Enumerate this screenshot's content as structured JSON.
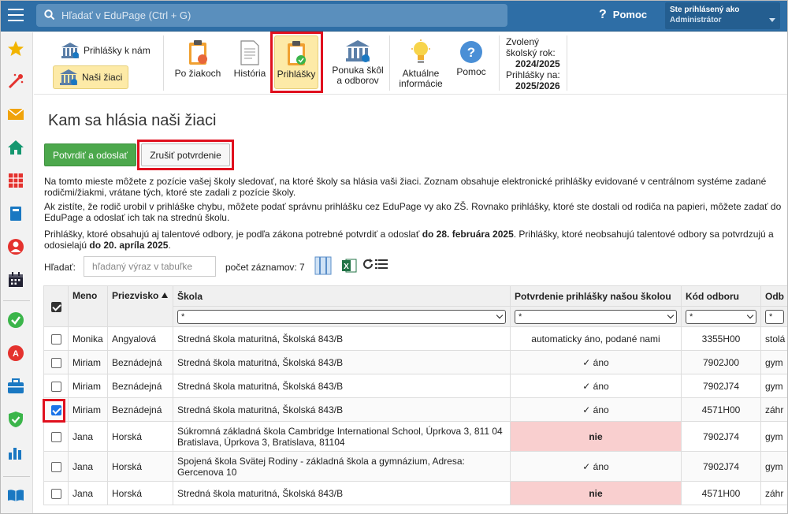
{
  "search": {
    "placeholder": "Hľadať v EduPage (Ctrl + G)"
  },
  "header": {
    "help_label": "Pomoc",
    "user_line1": "Ste prihlásený ako",
    "user_line2": "Administrátor"
  },
  "sidebar": {
    "icons": [
      "star-icon",
      "magic-wand-icon",
      "envelope-icon",
      "home-icon",
      "timetable-grid-icon",
      "book-icon",
      "person-icon",
      "calendar-icon",
      "check-circle-icon",
      "badge-icon",
      "briefcase-icon",
      "shield-check-icon",
      "bar-chart-icon",
      "open-book-icon"
    ]
  },
  "toolbar": {
    "prihlasky_k_nam": "Prihlášky k nám",
    "nasi_ziaci": "Naši žiaci",
    "po_ziakoch": "Po žiakoch",
    "historia": "História",
    "prihlasky": "Prihlášky",
    "ponuka_1": "Ponuka škôl",
    "ponuka_2": "a odborov",
    "aktualne_1": "Aktuálne",
    "aktualne_2": "informácie",
    "pomoc": "Pomoc",
    "year_l1": "Zvolený",
    "year_l2": "školský rok:",
    "year_v1": "2024/2025",
    "year_l3": "Prihlášky na:",
    "year_v2": "2025/2026"
  },
  "page": {
    "title": "Kam sa hlásia naši žiaci",
    "confirm_button": "Potvrdiť a odoslať",
    "cancel_button": "Zrušiť potvrdenie",
    "p1": "Na tomto mieste môžete z pozície vašej školy sledovať, na ktoré školy sa hlásia vaši žiaci. Zoznam obsahuje elektronické prihlášky evidované v centrálnom systéme zadané rodičmi/žiakmi, vrátane tých, ktoré ste zadali z pozície školy.",
    "p2": "Ak zistíte, že rodič urobil v prihláške chybu, môžete podať správnu prihlášku cez EduPage vy ako ZŠ. Rovnako prihlášky, ktoré ste dostali od rodiča na papieri, môžete zadať do EduPage a odoslať ich tak na strednú školu.",
    "p3a": "Prihlášky, ktoré obsahujú aj talentové odbory, je podľa zákona potrebné potvrdiť a odoslať ",
    "p3b": "do 28. februára 2025",
    "p3c": ". Prihlášky, ktoré neobsahujú talentové odbory sa potvrdzujú a odosielajú ",
    "p3d": "do 20. apríla 2025",
    "p3e": ".",
    "search_label": "Hľadať:",
    "search_placeholder": "hľadaný výraz v tabuľke",
    "count_label": "počet záznamov: 7"
  },
  "table": {
    "headers": {
      "meno": "Meno",
      "priezvisko": "Priezvisko",
      "skola": "Škola",
      "potvrdenie": "Potvrdenie prihlášky našou školou",
      "kod": "Kód odboru",
      "odbor": "Odb"
    },
    "filter": "*",
    "rows": [
      {
        "meno": "Monika",
        "priezvisko": "Angyalová",
        "skola": "Stredná škola maturitná, Školská 843/B",
        "potvrdenie": "automaticky áno, podané nami",
        "kod": "3355H00",
        "odbor": "stolá",
        "checked": false,
        "nie": false
      },
      {
        "meno": "Miriam",
        "priezvisko": "Beznádejná",
        "skola": "Stredná škola maturitná, Školská 843/B",
        "potvrdenie": "✓ áno",
        "kod": "7902J00",
        "odbor": "gym",
        "checked": false,
        "nie": false
      },
      {
        "meno": "Miriam",
        "priezvisko": "Beznádejná",
        "skola": "Stredná škola maturitná, Školská 843/B",
        "potvrdenie": "✓ áno",
        "kod": "7902J74",
        "odbor": "gym",
        "checked": false,
        "nie": false
      },
      {
        "meno": "Miriam",
        "priezvisko": "Beznádejná",
        "skola": "Stredná škola maturitná, Školská 843/B",
        "potvrdenie": "✓ áno",
        "kod": "4571H00",
        "odbor": "záhr",
        "checked": true,
        "nie": false
      },
      {
        "meno": "Jana",
        "priezvisko": "Horská",
        "skola": "Súkromná základná škola Cambridge International School, Úprkova 3, 811 04 Bratislava, Úprkova 3, Bratislava, 81104",
        "potvrdenie": "nie",
        "kod": "7902J74",
        "odbor": "gym",
        "checked": false,
        "nie": true
      },
      {
        "meno": "Jana",
        "priezvisko": "Horská",
        "skola": "Spojená škola Svätej Rodiny - základná škola a gymnázium, Adresa: Gercenova 10",
        "potvrdenie": "✓ áno",
        "kod": "7902J74",
        "odbor": "gym",
        "checked": false,
        "nie": false
      },
      {
        "meno": "Jana",
        "priezvisko": "Horská",
        "skola": "Stredná škola maturitná, Školská 843/B",
        "potvrdenie": "nie",
        "kod": "4571H00",
        "odbor": "záhr",
        "checked": false,
        "nie": true
      }
    ]
  }
}
